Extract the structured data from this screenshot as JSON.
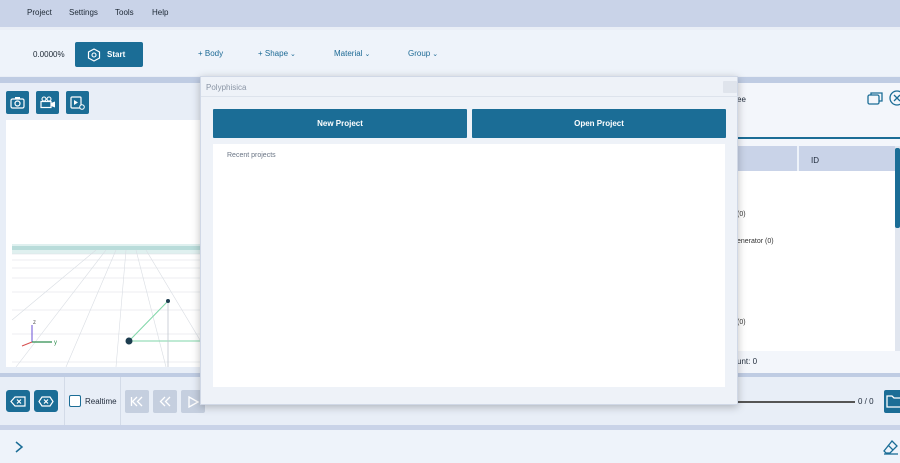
{
  "menu": [
    "Project",
    "Settings",
    "Tools",
    "Help"
  ],
  "toolbar": {
    "progress": "0.0000%",
    "start_label": "Start",
    "body_label": "+ Body",
    "shape_label": "+ Shape",
    "material_label": "Material",
    "group_label": "Group"
  },
  "viewport": {
    "axis_z": "z",
    "axis_y": "y"
  },
  "tree": {
    "title": "ee",
    "id_header": "ID",
    "lines": [
      "(0)",
      "enerator (0)",
      "(0)"
    ],
    "count": "unt: 0"
  },
  "controls": {
    "realtime_label": "Realtime",
    "frame_label": "0 / 0"
  },
  "modal": {
    "title": "Polyphisica",
    "new_project": "New Project",
    "open_project": "Open Project",
    "recent_label": "Recent projects"
  },
  "colors": {
    "accent": "#1b6d96",
    "menubar": "#c9d3e8",
    "background": "#e9eef6"
  },
  "icons": [
    "camera-icon",
    "video-camera-icon",
    "video-settings-icon",
    "start-hex-icon",
    "backspace-icon",
    "clear-icon",
    "skip-start-icon",
    "rewind-icon",
    "play-icon",
    "stop-icon",
    "forward-icon",
    "skip-end-icon",
    "folder-icon",
    "window-restore-icon",
    "close-circle-icon",
    "chevron-right-icon",
    "eraser-icon"
  ]
}
